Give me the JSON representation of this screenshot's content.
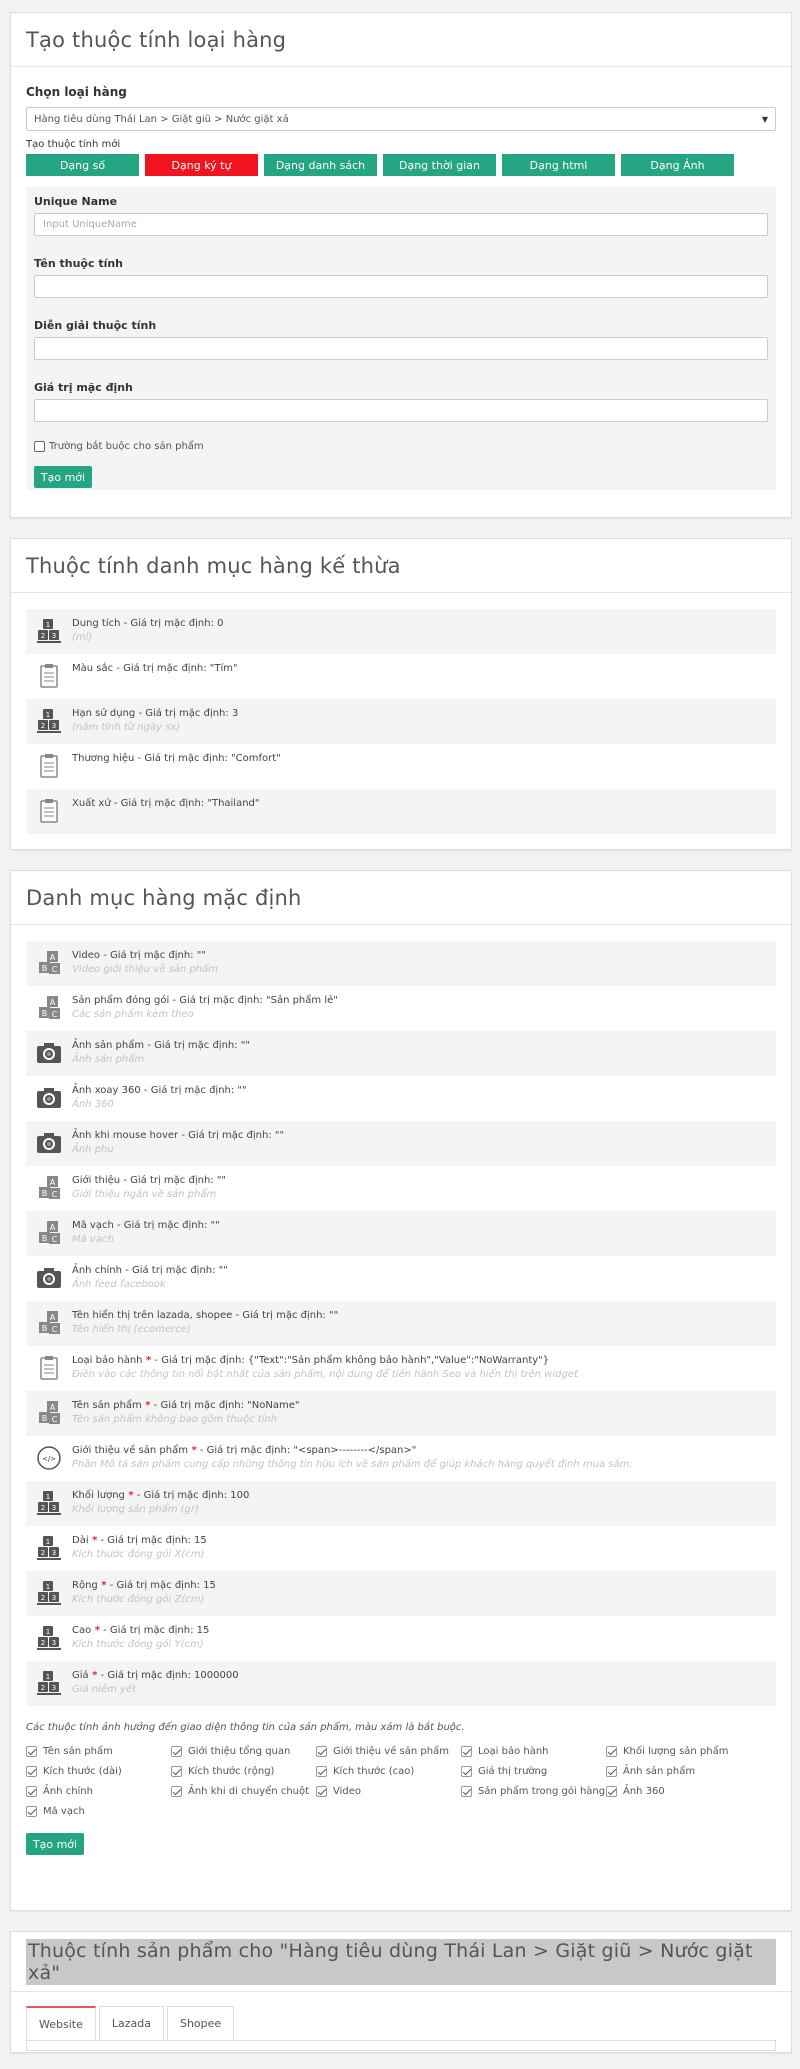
{
  "create_panel": {
    "title": "Tạo thuộc tính loại hàng",
    "choose_label": "Chọn loại hàng",
    "selected_category": "Hàng tiêu dùng Thái Lan > Giặt giũ > Nước giặt xả",
    "new_attr_label": "Tạo thuộc tính mới",
    "type_buttons": [
      "Dạng số",
      "Dạng ký tự",
      "Dạng danh sách",
      "Dạng thời gian",
      "Dạng html",
      "Dạng Ảnh"
    ],
    "active_type": "Dạng ký tự",
    "fields": {
      "unique_name_label": "Unique Name",
      "unique_name_placeholder": "Input UniqueName",
      "attr_name_label": "Tên thuộc tính",
      "attr_desc_label": "Diễn giải thuộc tính",
      "default_value_label": "Giá trị mặc định"
    },
    "required_checkbox_label": "Trường bắt buộc cho sản phẩm",
    "required_checked": false,
    "create_button": "Tạo mới"
  },
  "inherited_panel": {
    "title": "Thuộc tính danh mục hàng kế thừa",
    "items": [
      {
        "icon": "number-icon",
        "text": "Dung tích - Giá trị mặc định: 0",
        "sub": "(ml)"
      },
      {
        "icon": "list-icon",
        "text": "Màu sắc - Giá trị mặc định: \"Tím\"",
        "sub": ""
      },
      {
        "icon": "number-icon",
        "text": "Hạn sử dụng - Giá trị mặc định: 3",
        "sub": "(năm tính từ ngày sx)"
      },
      {
        "icon": "list-icon",
        "text": "Thương hiệu - Giá trị mặc định: \"Comfort\"",
        "sub": ""
      },
      {
        "icon": "list-icon",
        "text": "Xuất xứ - Giá trị mặc định: \"Thailand\"",
        "sub": ""
      }
    ]
  },
  "default_panel": {
    "title": "Danh mục hàng mặc định",
    "items": [
      {
        "icon": "text-icon",
        "name": "Video",
        "req": false,
        "value": " - Giá trị mặc định: \"\"",
        "sub": "Video giới thiệu về sản phẩm"
      },
      {
        "icon": "text-icon",
        "name": "Sản phẩm đóng gói",
        "req": false,
        "value": " - Giá trị mặc định: \"Sản phẩm lẻ\"",
        "sub": "Các sản phẩm kèm theo"
      },
      {
        "icon": "camera-icon",
        "name": "Ảnh sản phẩm",
        "req": false,
        "value": " - Giá trị mặc định: \"\"",
        "sub": "Ảnh sản phẩm"
      },
      {
        "icon": "camera-icon",
        "name": "Ảnh xoay 360",
        "req": false,
        "value": " - Giá trị mặc định: \"\"",
        "sub": "Ảnh 360"
      },
      {
        "icon": "camera-icon",
        "name": "Ảnh khi mouse hover",
        "req": false,
        "value": " - Giá trị mặc định: \"\"",
        "sub": "Ảnh phụ"
      },
      {
        "icon": "text-icon",
        "name": "Giới thiệu",
        "req": false,
        "value": " - Giá trị mặc định: \"\"",
        "sub": "Giới thiệu ngắn về sản phẩm"
      },
      {
        "icon": "text-icon",
        "name": "Mã vạch",
        "req": false,
        "value": " - Giá trị mặc định: \"\"",
        "sub": "Mã vạch"
      },
      {
        "icon": "camera-icon",
        "name": "Ảnh chính",
        "req": false,
        "value": " - Giá trị mặc định: \"\"",
        "sub": "Ảnh feed facebook"
      },
      {
        "icon": "text-icon",
        "name": "Tên hiển thị trên lazada, shopee",
        "req": false,
        "value": " - Giá trị mặc định: \"\"",
        "sub": "Tên hiển thị (ecomerce)"
      },
      {
        "icon": "list-icon",
        "name": "Loại bảo hành",
        "req": true,
        "value": " - Giá trị mặc định: {\"Text\":\"Sản phẩm không bảo hành\",\"Value\":\"NoWarranty\"}",
        "sub": "Điền vào các thông tin nổi bật nhất của sản phẩm, nội dung để tiến hành Seo và hiển thị trên widget"
      },
      {
        "icon": "text-icon",
        "name": "Tên sản phẩm",
        "req": true,
        "value": " - Giá trị mặc định: \"NoName\"",
        "sub": "Tên sản phẩm không bao gồm thuộc tính"
      },
      {
        "icon": "html-icon",
        "name": "Giới thiệu về sản phẩm",
        "req": true,
        "value": " - Giá trị mặc định: \"<span>--------</span>\"",
        "sub": "Phần Mô tả sản phẩm cung cấp những thông tin hữu ích về sản phẩm để giúp khách hàng quyết định mua sắm."
      },
      {
        "icon": "number-icon",
        "name": "Khối lượng",
        "req": true,
        "value": " - Giá trị mặc định: 100",
        "sub": "Khối lượng sản phẩm (gr)"
      },
      {
        "icon": "number-icon",
        "name": "Dài",
        "req": true,
        "value": " - Giá trị mặc định: 15",
        "sub": "Kích thước đóng gói X(cm)"
      },
      {
        "icon": "number-icon",
        "name": "Rộng",
        "req": true,
        "value": " - Giá trị mặc định: 15",
        "sub": "Kích thước đóng gói Z(cm)"
      },
      {
        "icon": "number-icon",
        "name": "Cao",
        "req": true,
        "value": " - Giá trị mặc định: 15",
        "sub": "Kích thước đóng gói Y(cm)"
      },
      {
        "icon": "number-icon",
        "name": "Giá",
        "req": true,
        "value": " - Giá trị mặc định: 1000000",
        "sub": "Giá niêm yết"
      }
    ],
    "req_mark": "*",
    "note": "Các thuộc tính ảnh hưởng đến giao diện thông tin của sản phẩm, màu xám là bắt buộc.",
    "checkboxes": [
      "Tên sản phẩm",
      "Giới thiệu tổng quan",
      "Giới thiệu về sản phẩm",
      "Loại bảo hành",
      "Khối lượng sản phẩm",
      "Kích thước (dài)",
      "Kích thước (rộng)",
      "Kích thước (cao)",
      "Giá thị trường",
      "Ảnh sản phẩm",
      "Ảnh chính",
      "Ảnh khi di chuyển chuột",
      "Video",
      "Sản phẩm trong gói hàng",
      "Ảnh 360",
      "Mã vạch"
    ],
    "create_button": "Tạo mới"
  },
  "product_panel": {
    "title": "Thuộc tính sản phẩm cho \"Hàng tiêu dùng Thái Lan > Giặt giũ > Nước giặt xả\"",
    "tabs": [
      "Website",
      "Lazada",
      "Shopee"
    ],
    "active_tab": "Website"
  },
  "colors": {
    "accent": "#26a583",
    "active": "#f0141e",
    "title_highlight": "#c8c8c8"
  }
}
